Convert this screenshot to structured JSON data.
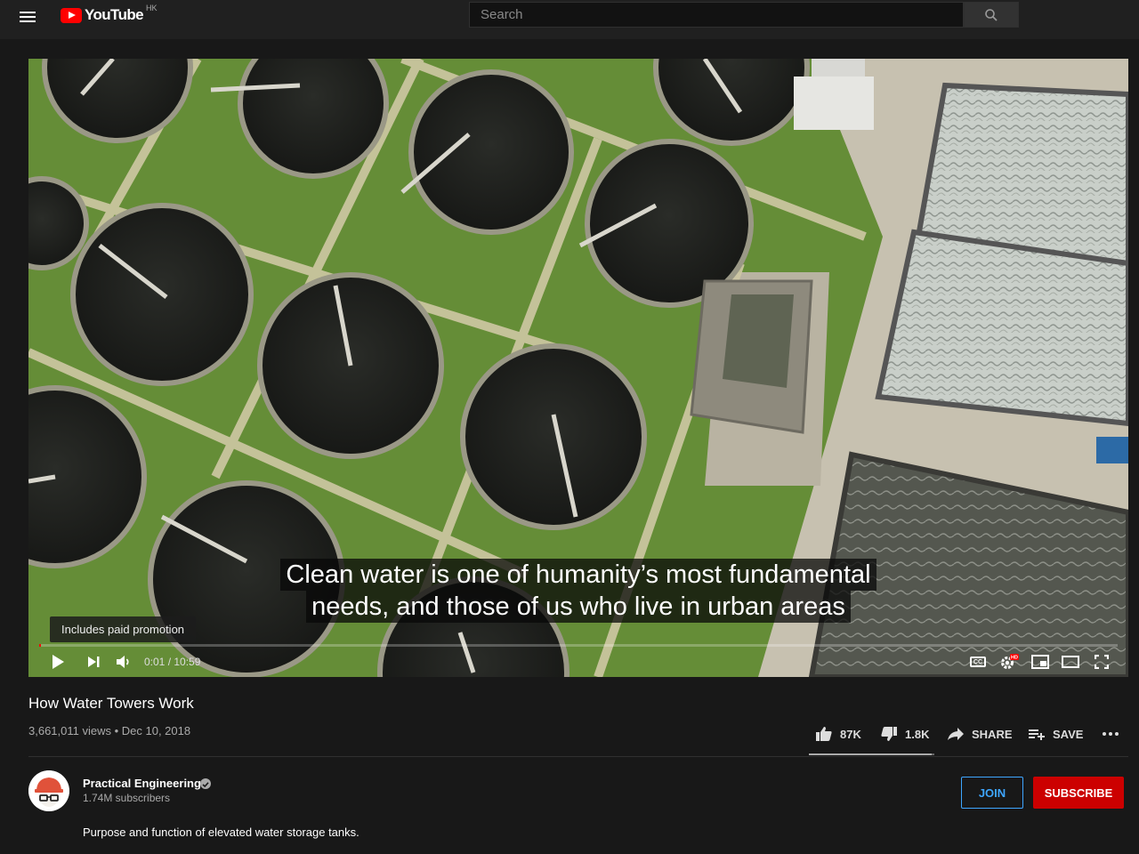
{
  "header": {
    "logo_text": "YouTube",
    "country_code": "HK",
    "search_placeholder": "Search"
  },
  "player": {
    "captions": [
      "Clean water is one of humanity’s most fundamental",
      "needs, and those of us who live in urban areas"
    ],
    "promo_label": "Includes paid promotion",
    "current_time": "0:01",
    "duration": "10:59",
    "time_display": "0:01 / 10:59",
    "progress_fraction": 0.0015,
    "cc_label": "CC",
    "hd_badge": "HD"
  },
  "video": {
    "title": "How Water Towers Work",
    "views": "3,661,011 views",
    "separator": "•",
    "date": "Dec 10, 2018",
    "meta_line": "3,661,011 views • Dec 10, 2018",
    "likes": "87K",
    "dislikes": "1.8K",
    "share_label": "SHARE",
    "save_label": "SAVE",
    "like_fraction": 0.98
  },
  "channel": {
    "name": "Practical Engineering",
    "subscribers": "1.74M subscribers",
    "join_label": "JOIN",
    "subscribe_label": "SUBSCRIBE",
    "description": "Purpose and function of elevated water storage tanks."
  },
  "colors": {
    "background": "#181818",
    "topbar": "#202020",
    "brand_red": "#ff0000",
    "subscribe_red": "#cc0000",
    "join_blue": "#3ea6ff",
    "grass": "#6f9a3a",
    "tank_water": "#1c1e1c"
  },
  "icons": [
    "menu-icon",
    "youtube-logo-icon",
    "search-icon",
    "play-icon",
    "next-icon",
    "volume-icon",
    "cc-icon",
    "settings-icon",
    "miniplayer-icon",
    "theater-icon",
    "fullscreen-icon",
    "thumbs-up-icon",
    "thumbs-down-icon",
    "share-icon",
    "save-playlist-icon",
    "more-icon",
    "verified-icon"
  ]
}
